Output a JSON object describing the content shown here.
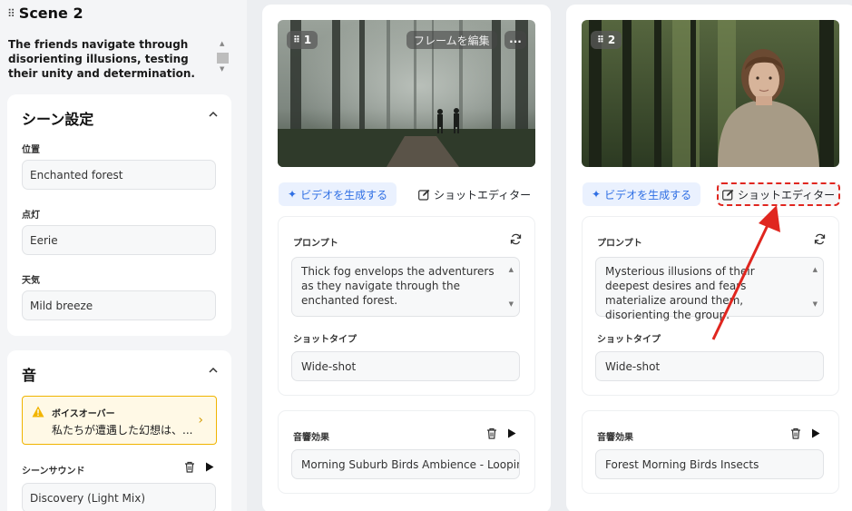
{
  "scene": {
    "title": "Scene 2",
    "description": "The friends navigate through disorienting illusions, testing their unity and determination."
  },
  "settings": {
    "title": "シーン設定",
    "location_label": "位置",
    "location_value": "Enchanted forest",
    "lighting_label": "点灯",
    "lighting_value": "Eerie",
    "weather_label": "天気",
    "weather_value": "Mild breeze"
  },
  "sound": {
    "title": "音",
    "voiceover_label": "ボイスオーバー",
    "voiceover_text": "私たちが遭遇した幻想は、...",
    "scene_sound_label": "シーンサウンド",
    "scene_sound_value": "Discovery (Light Mix)"
  },
  "shots": [
    {
      "number": "1",
      "frame_edit_label": "フレームを編集",
      "more_label": "...",
      "generate_label": "ビデオを生成する",
      "editor_label": "ショットエディター",
      "prompt_label": "プロンプト",
      "prompt_text": "Thick fog envelops the adventurers as they navigate through the enchanted forest.",
      "shot_type_label": "ショットタイプ",
      "shot_type_value": "Wide-shot",
      "sfx_label": "音響効果",
      "sfx_value": "Morning Suburb Birds Ambience - Loopin"
    },
    {
      "number": "2",
      "generate_label": "ビデオを生成する",
      "editor_label": "ショットエディター",
      "prompt_label": "プロンプト",
      "prompt_text": "Mysterious illusions of their deepest desires and fears materialize around them, disorienting the group.",
      "shot_type_label": "ショットタイプ",
      "shot_type_value": "Wide-shot",
      "sfx_label": "音響効果",
      "sfx_value": "Forest Morning Birds Insects"
    }
  ],
  "colors": {
    "accent_blue": "#2f6fe4",
    "highlight_red": "#e0261f",
    "warning_yellow": "#f0b400"
  },
  "icons": [
    "drag-grip-icon",
    "chevron-up-icon",
    "warning-icon",
    "chevron-right-icon",
    "trash-icon",
    "play-icon",
    "sparkle-icon",
    "edit-icon",
    "refresh-icon",
    "more-icon"
  ]
}
